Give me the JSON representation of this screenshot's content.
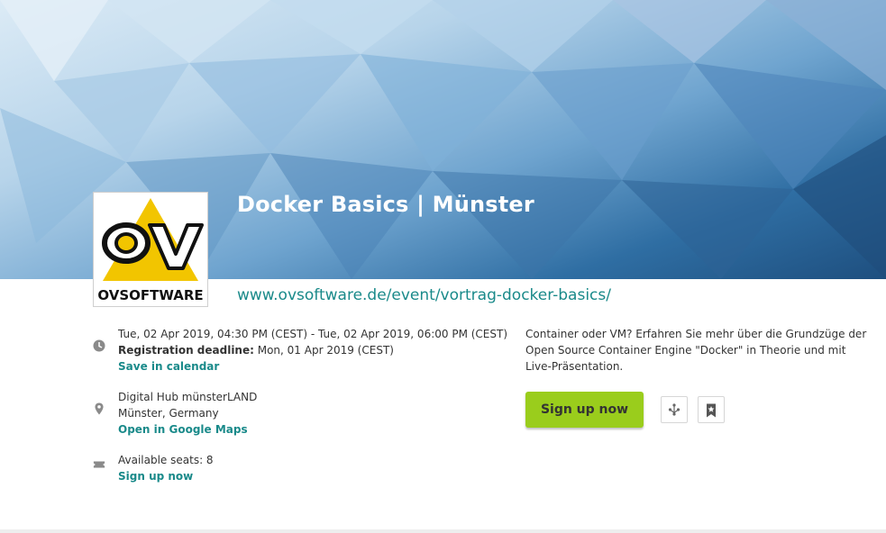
{
  "event": {
    "title": "Docker Basics | Münster",
    "url": "www.ovsoftware.de/event/vortrag-docker-basics/",
    "logo_text": "OVSOFTWARE"
  },
  "date": {
    "range": "Tue, 02 Apr 2019, 04:30 PM (CEST) - Tue, 02 Apr 2019, 06:00 PM (CEST)",
    "deadline_label": "Registration deadline:",
    "deadline_value": " Mon, 01 Apr 2019 (CEST)",
    "calendar_link": "Save in calendar"
  },
  "location": {
    "venue": "Digital Hub münsterLAND",
    "city": "Münster, Germany",
    "maps_link": "Open in Google Maps"
  },
  "seats": {
    "label": "Available seats: 8",
    "signup_link": "Sign up now"
  },
  "description": "Container oder VM? Erfahren Sie mehr über die Grundzüge der Open Source Container Engine \"Docker\" in Theorie und mit Live-Präsentation.",
  "actions": {
    "signup_label": "Sign up now"
  },
  "colors": {
    "accent_green": "#9acd1c",
    "link_teal": "#1a8a8a",
    "logo_yellow": "#f2c500"
  }
}
